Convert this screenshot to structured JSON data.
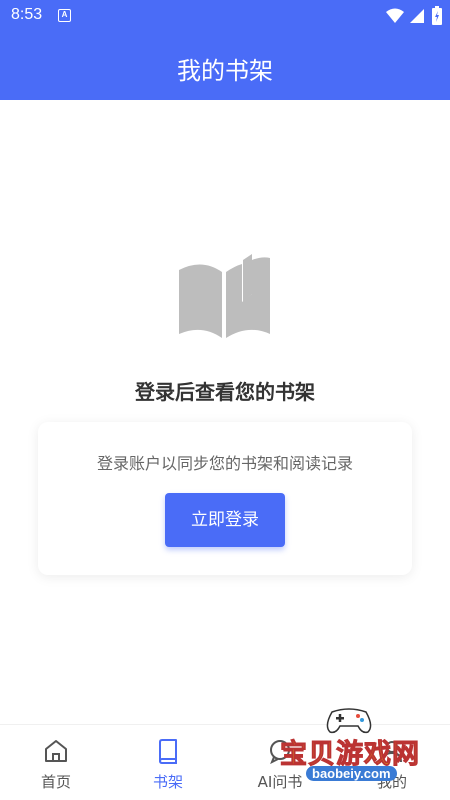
{
  "status_bar": {
    "time": "8:53",
    "notification_icon": "A"
  },
  "app_bar": {
    "title": "我的书架"
  },
  "empty_state": {
    "icon": "book-icon",
    "title": "登录后查看您的书架",
    "card": {
      "hint": "登录账户以同步您的书架和阅读记录",
      "login_button": "立即登录"
    }
  },
  "tab_bar": {
    "tabs": [
      {
        "label": "首页",
        "icon": "home-icon",
        "active": false
      },
      {
        "label": "书架",
        "icon": "bookshelf-icon",
        "active": true
      },
      {
        "label": "AI问书",
        "icon": "chat-icon",
        "active": false
      },
      {
        "label": "我的",
        "icon": "user-icon",
        "active": false
      }
    ]
  },
  "watermark": {
    "text": "宝贝游戏网",
    "url": "baobeiy.com"
  },
  "colors": {
    "primary": "#4a6cf7",
    "text_dark": "#333333",
    "text_muted": "#666666",
    "icon_gray": "#bdbdbd"
  }
}
